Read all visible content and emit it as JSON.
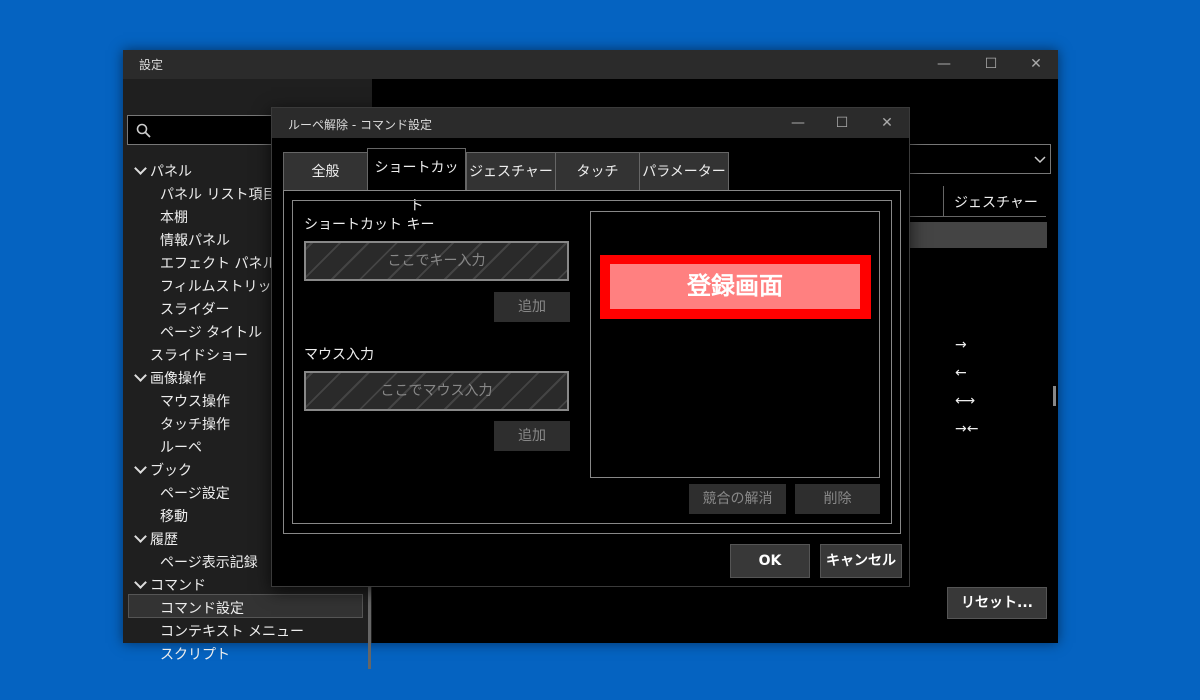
{
  "main_window": {
    "title": "設定",
    "controls": {
      "minimize": "—",
      "maximize": "☐",
      "close": "✕"
    }
  },
  "sidebar": {
    "search_value": "",
    "tree": [
      {
        "label": "パネル",
        "level": 0,
        "expanded": true
      },
      {
        "label": "パネル リスト項目",
        "level": 1
      },
      {
        "label": "本棚",
        "level": 1
      },
      {
        "label": "情報パネル",
        "level": 1
      },
      {
        "label": "エフェクト パネル",
        "level": 1
      },
      {
        "label": "フィルムストリップ",
        "level": 1
      },
      {
        "label": "スライダー",
        "level": 1
      },
      {
        "label": "ページ タイトル",
        "level": 1
      },
      {
        "label": "スライドショー",
        "level": 0
      },
      {
        "label": "画像操作",
        "level": 0,
        "expanded": true
      },
      {
        "label": "マウス操作",
        "level": 1
      },
      {
        "label": "タッチ操作",
        "level": 1
      },
      {
        "label": "ルーペ",
        "level": 1
      },
      {
        "label": "ブック",
        "level": 0,
        "expanded": true
      },
      {
        "label": "ページ設定",
        "level": 1
      },
      {
        "label": "移動",
        "level": 1
      },
      {
        "label": "履歴",
        "level": 0,
        "expanded": true
      },
      {
        "label": "ページ表示記録",
        "level": 1
      },
      {
        "label": "コマンド",
        "level": 0,
        "expanded": true
      },
      {
        "label": "コマンド設定",
        "level": 1,
        "selected": true
      },
      {
        "label": "コンテキスト メニュー",
        "level": 1
      },
      {
        "label": "スクリプト",
        "level": 1
      }
    ]
  },
  "main_content": {
    "column_header": "ジェスチャー",
    "gestures": [
      "→",
      "←",
      "⟷",
      "→←"
    ],
    "reset_button": "リセット..."
  },
  "dialog": {
    "title": "ルーペ解除 - コマンド設定",
    "tabs": [
      "全般",
      "ショートカット",
      "ジェスチャー",
      "タッチ",
      "パラメーター"
    ],
    "active_tab": "ショートカット",
    "shortcut_section_label": "ショートカット キー",
    "shortcut_placeholder": "ここでキー入力",
    "add_label": "追加",
    "mouse_section_label": "マウス入力",
    "mouse_placeholder": "ここでマウス入力",
    "register_label": "登録画面",
    "resolve_conflict_label": "競合の解消",
    "delete_label": "削除",
    "ok_label": "OK",
    "cancel_label": "キャンセル"
  },
  "colors": {
    "desktop": "#0563c1",
    "highlight_frame": "#ff0000",
    "highlight_fill": "#ff8080"
  }
}
